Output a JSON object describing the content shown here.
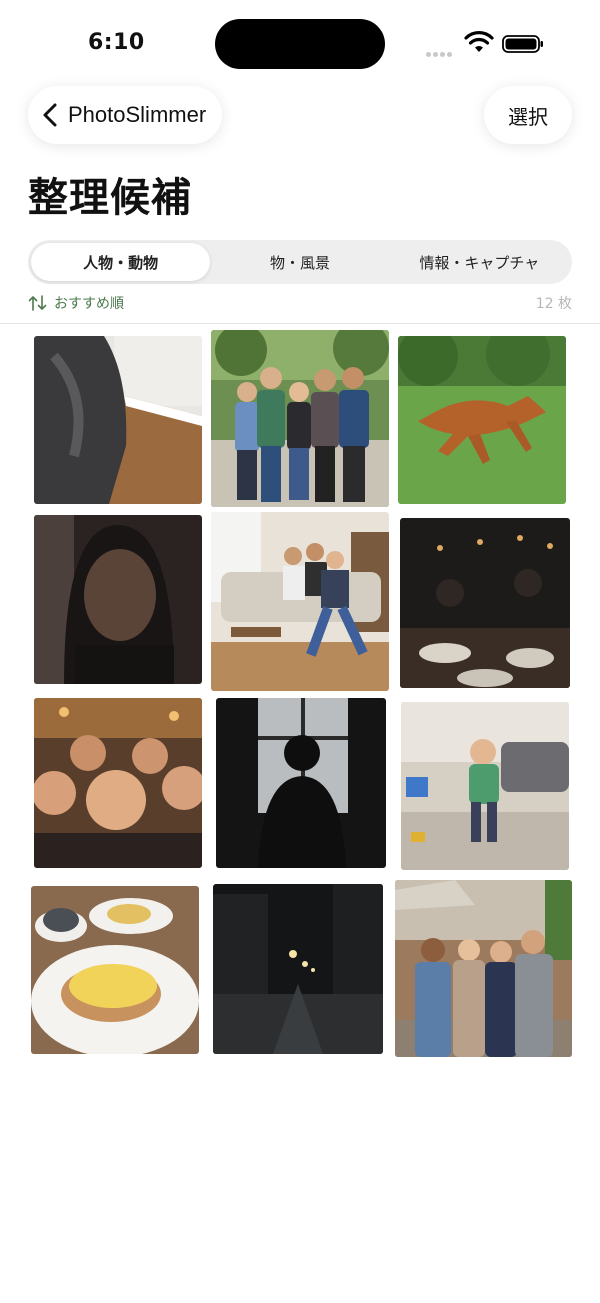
{
  "status_bar": {
    "time": "6:10"
  },
  "nav": {
    "back_label": "PhotoSlimmer",
    "select_label": "選択"
  },
  "page": {
    "title": "整理候補"
  },
  "tabs": [
    {
      "label": "人物・動物",
      "active": true
    },
    {
      "label": "物・風景",
      "active": false
    },
    {
      "label": "情報・キャプチャ",
      "active": false
    }
  ],
  "sort": {
    "label": "おすすめ順",
    "count": "12 枚"
  },
  "colors": {
    "accent": "#4a7a4e",
    "muted": "#b7b7b7",
    "segment_bg": "#eeeeef"
  },
  "photos": [
    {
      "name": "blurred-wall-photo"
    },
    {
      "name": "group-friends-park-photo"
    },
    {
      "name": "dog-running-photo"
    },
    {
      "name": "dark-selfie-photo"
    },
    {
      "name": "family-living-room-photo"
    },
    {
      "name": "dark-dinner-photo"
    },
    {
      "name": "blurry-group-selfie-photo"
    },
    {
      "name": "silhouette-window-photo"
    },
    {
      "name": "blurry-child-running-photo"
    },
    {
      "name": "breakfast-plate-photo"
    },
    {
      "name": "night-street-photo"
    },
    {
      "name": "four-friends-photo"
    }
  ]
}
